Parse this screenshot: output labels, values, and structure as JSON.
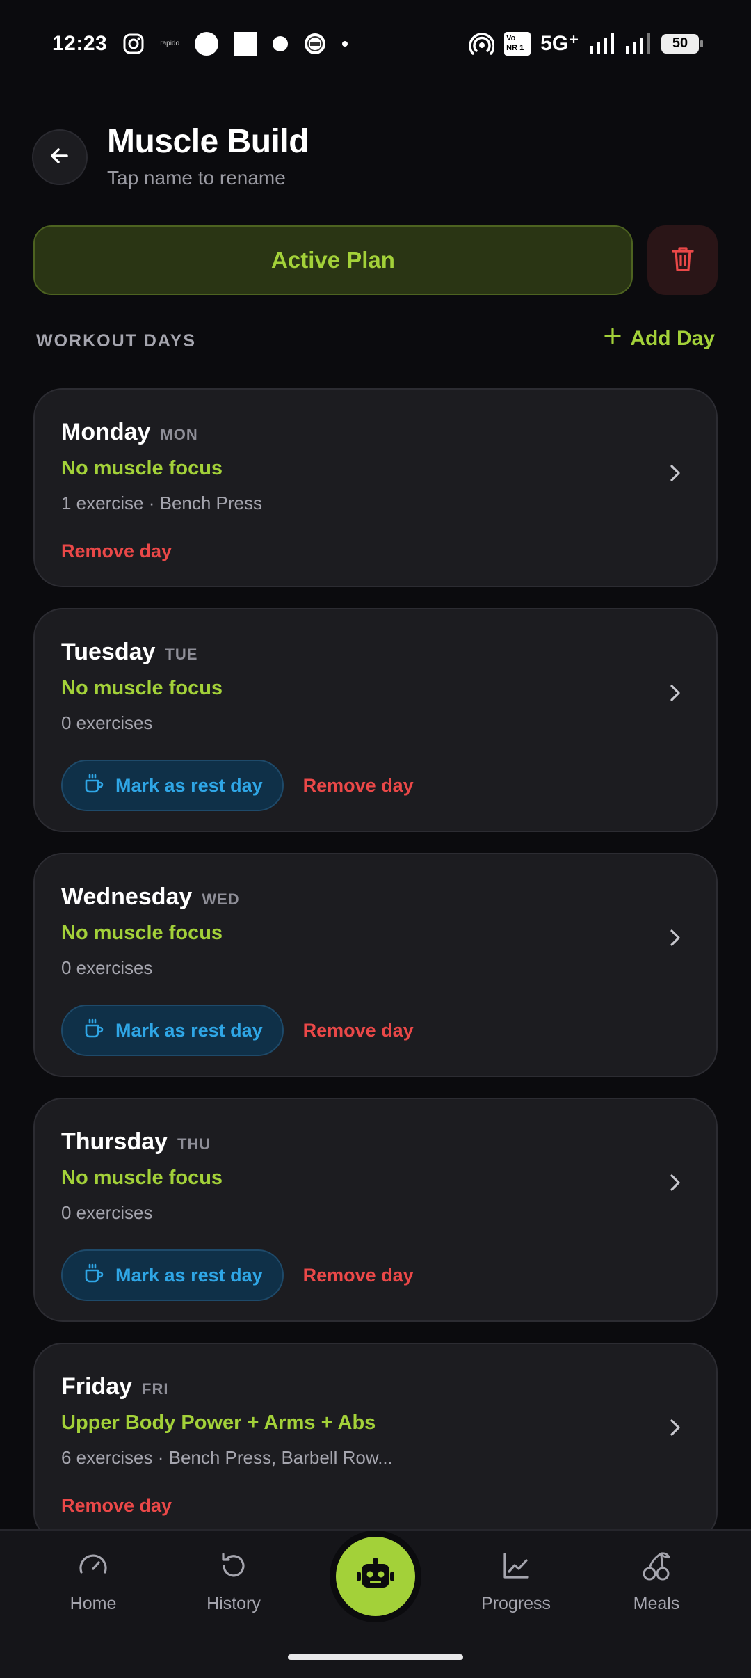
{
  "status_bar": {
    "time": "12:23",
    "rapido_label": "rapido",
    "vonr_label": "Vo NR",
    "vonr_sim": "1",
    "network": "5G⁺",
    "battery": "50"
  },
  "header": {
    "title": "Muscle Build",
    "subtitle": "Tap name to rename"
  },
  "plan": {
    "active_label": "Active Plan"
  },
  "section": {
    "label": "WORKOUT DAYS",
    "add_day_label": "Add Day"
  },
  "days": [
    {
      "name": "Monday",
      "abbr": "MON",
      "focus": "No muscle focus",
      "meta": "1 exercise · Bench Press",
      "remove_label": "Remove day"
    },
    {
      "name": "Tuesday",
      "abbr": "TUE",
      "focus": "No muscle focus",
      "meta": "0 exercises",
      "rest_label": "Mark as rest day",
      "remove_label": "Remove day"
    },
    {
      "name": "Wednesday",
      "abbr": "WED",
      "focus": "No muscle focus",
      "meta": "0 exercises",
      "rest_label": "Mark as rest day",
      "remove_label": "Remove day"
    },
    {
      "name": "Thursday",
      "abbr": "THU",
      "focus": "No muscle focus",
      "meta": "0 exercises",
      "rest_label": "Mark as rest day",
      "remove_label": "Remove day"
    },
    {
      "name": "Friday",
      "abbr": "FRI",
      "focus": "Upper Body Power + Arms + Abs",
      "meta": "6 exercises · Bench Press, Barbell Row...",
      "remove_label": "Remove day"
    }
  ],
  "bottom_nav": {
    "home": "Home",
    "history": "History",
    "progress": "Progress",
    "meals": "Meals"
  },
  "colors": {
    "accent_green": "#a3d139",
    "rest_blue": "#2fa6e6",
    "danger_red": "#ea4848",
    "card_bg": "#1c1c20",
    "page_bg": "#0b0b0e"
  }
}
